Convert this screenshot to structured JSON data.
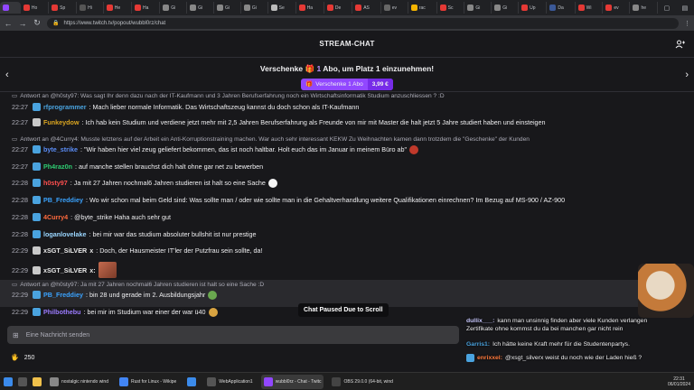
{
  "browser": {
    "url": "https://www.twitch.tv/popout/wubbl0rz/chat",
    "tabs": [
      "Ho",
      "Sp",
      "Hi",
      "He",
      "Ha",
      "Gi",
      "Gi",
      "Gi",
      "Gi",
      "Se",
      "Ha",
      "De",
      "AS",
      "ev",
      "rac",
      "Sc",
      "Gi",
      "Gi",
      "Up",
      "Da",
      "Wi",
      "ev",
      "he"
    ]
  },
  "chat": {
    "title": "STREAM-CHAT",
    "gift": {
      "line_prefix": "Verschenke",
      "line_count": "1",
      "line_suffix": "Abo, um Platz 1 einzunehmen!",
      "button_label": "Verschenke 1 Abo",
      "price": "3,99 €"
    },
    "messages": [
      {
        "reply": "Antwort an @h0sty97: Was sagt Ihr denn dazu nach der IT-Kaufmann und 3 Jahren Berufserfahrung noch ein Wirtschaftsinformatik Studium anzuschliessen ? :D"
      },
      {
        "time": "22:27",
        "user": "rfprogrammer",
        "color": "#4aa3df",
        "text": ": Mach lieber normale Informatik. Das Wirtschaftszeug kannst du doch schon als IT-Kaufmann"
      },
      {
        "time": "22:27",
        "user": "Funkeydow",
        "color": "#daa520",
        "text": ": Ich hab kein Studium und verdiene jetzt mehr mit 2,5 Jahren Berufserfahrung als Freunde von mir mit Master die halt jetzt 5 Jahre studiert haben und einsteigen"
      },
      {
        "reply": "Antwort an @4Curry4: Musste letztens auf der Arbeit ein Anti-Korruptionstraining machen. War auch sehr interessant KEKW Zu Weihnachten kamen dann trotzdem die \"Geschenke\" der Kunden"
      },
      {
        "time": "22:27",
        "user": "byte_strike",
        "color": "#5b8df7",
        "text": ": \"Wir haben hier viel zeug geliefert bekommen, das ist noch haltbar. Holt euch das im Januar in meinem Büro ab\""
      },
      {
        "time": "22:27",
        "user": "Ph4raz0n",
        "color": "#2ecc71",
        "text": ": auf manche stellen brauchst dich halt ohne gar net zu bewerben"
      },
      {
        "time": "22:28",
        "user": "h0sty97",
        "color": "#ff4f4f",
        "text": ": Ja mit 27 Jahren nochmal6 Jahren studieren ist halt so eine Sache"
      },
      {
        "time": "22:28",
        "user": "PB_Freddiey",
        "color": "#3aa3ff",
        "text": ": Wo wir schon mal beim Geld sind: Was sollte man / oder wie sollte man in die Gehaltverhandlung weitere Qualifikationen einrechnen? Im Bezug auf MS-900 / AZ-900"
      },
      {
        "time": "22:28",
        "user": "4Curry4",
        "color": "#ff6a3d",
        "text": ": @byte_strike Haha auch sehr gut"
      },
      {
        "time": "22:28",
        "user": "loganlovelake",
        "color": "#9ad6ff",
        "text": ": bei mir war das studium absoluter bullshit ist nur prestige"
      },
      {
        "time": "22:29",
        "user": "xSGT_SiLVER",
        "suffix": "x",
        "color": "#e8e8e8",
        "text": ": Doch, der Hausmeister IT'ler der Putzfrau sein sollte, da!"
      },
      {
        "time": "22:29",
        "user": "xSGT_SiLVER",
        "suffix": "x:",
        "color": "#e8e8e8",
        "text": ""
      },
      {
        "reply": "Antwort an @h0sty97: Ja mit 27 Jahren nochmal6 Jahren studieren ist halt so eine Sache :D"
      },
      {
        "time": "22:29",
        "user": "PB_Freddiey",
        "color": "#3aa3ff",
        "text": ": bin 28 und gerade im 2. Ausbildungsjahr"
      },
      {
        "time": "22:29",
        "user": "Philbothebu",
        "color": "#9b7bff",
        "text": ": bei mir im Studium war einer der war ü40"
      }
    ],
    "paused_label": "Chat Paused Due to Scroll",
    "input_placeholder": "Eine Nachricht senden",
    "points": "250"
  },
  "overlay": [
    {
      "user": "dullix___:",
      "color": "#c9c9ff",
      "text": "kann man unsinnig finden aber viele Kunden verlangen"
    },
    {
      "user": "",
      "color": "#ffffff",
      "text": "Zertifikate ohne kommst du da bei manchen gar nicht rein"
    },
    {
      "user": "Garris1:",
      "color": "#4aa3df",
      "text": "Ich hätte keine Kraft mehr für die Studentenpartys."
    },
    {
      "user": "enrixxel:",
      "color": "#ff7a3d",
      "text": "@xsgt_silverx weist du noch wie der Laden hieß ?"
    }
  ],
  "taskbar": {
    "apps": [
      "nostalgic nintendo wind",
      "Rust for Linux - Wikipe",
      "",
      "WebApplication1",
      "wubbl0rz - Chat - Twitc",
      "OBS 29.0.0 (64-bit, wind"
    ],
    "time": "22:31",
    "date": "06/01/2024"
  },
  "colors": {
    "accent": "#9147ff",
    "background": "#18181b"
  }
}
